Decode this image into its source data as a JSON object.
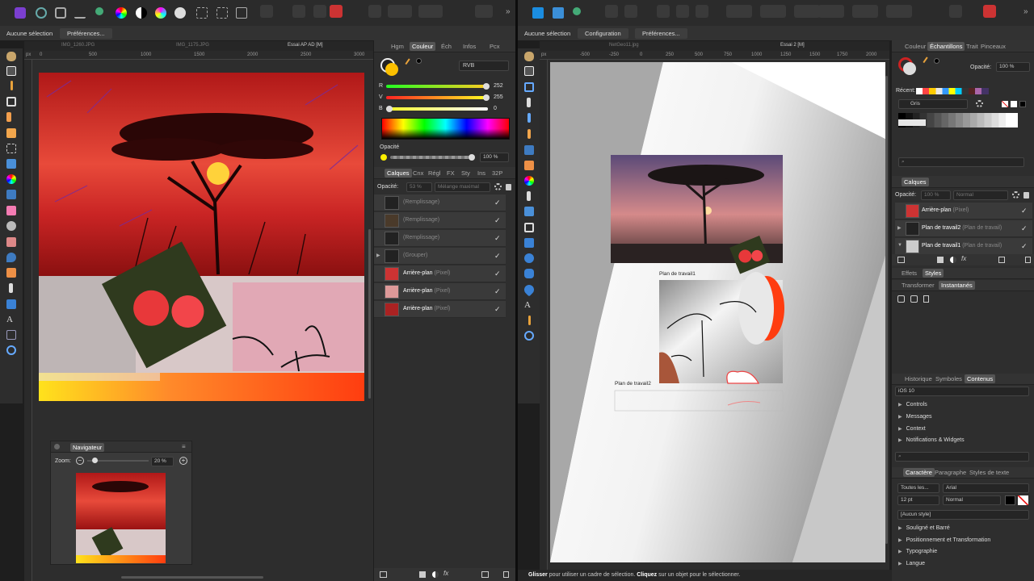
{
  "left": {
    "context": {
      "no_selection": "Aucune sélection",
      "prefs": "Préférences..."
    },
    "doc_tabs": [
      "IMG_1260.JPG",
      "IMG_1175.JPG",
      "Essai AP AD [M]"
    ],
    "ruler_unit": "px",
    "ruler_ticks": [
      "0",
      "500",
      "1000",
      "1500",
      "2000",
      "2500",
      "3000"
    ],
    "color_panel": {
      "tabs": [
        "Hgm",
        "Couleur",
        "Éch",
        "Infos",
        "Pcx"
      ],
      "mode": "RVB",
      "r_label": "R",
      "r": "252",
      "g_label": "V",
      "g": "255",
      "b_label": "B",
      "b": "0",
      "opacity_label": "Opacité",
      "opacity": "100 %"
    },
    "layers_panel": {
      "tabs": [
        "Calques",
        "Cnx",
        "Régl",
        "FX",
        "Sty",
        "Ins",
        "32P"
      ],
      "opacity_label": "Opacité:",
      "opacity": "53 %",
      "blend": "Mélange maximal",
      "layers": [
        {
          "name": "",
          "type": "(Remplissage)"
        },
        {
          "name": "",
          "type": "(Remplissage)"
        },
        {
          "name": "",
          "type": "(Remplissage)"
        },
        {
          "name": "",
          "type": "(Grouper)"
        },
        {
          "name": "Arrière-plan",
          "type": "(Pixel)"
        },
        {
          "name": "Arrière-plan",
          "type": "(Pixel)"
        },
        {
          "name": "Arrière-plan",
          "type": "(Pixel)"
        }
      ]
    },
    "navigator": {
      "title": "Navigateur",
      "zoom_label": "Zoom:",
      "zoom": "20 %"
    }
  },
  "right": {
    "context": {
      "no_selection": "Aucune sélection",
      "config": "Configuration",
      "prefs": "Préférences..."
    },
    "doc_tabs": [
      "NetGeo11.jpg",
      "Essai 2 [M]"
    ],
    "ruler_unit": "px",
    "ruler_ticks": [
      "-500",
      "-250",
      "0",
      "250",
      "500",
      "750",
      "1000",
      "1250",
      "1500",
      "1750",
      "2000"
    ],
    "artboard_labels": [
      "Plan de travail1",
      "Plan de travail2"
    ],
    "top_tabs": [
      "Couleur",
      "Échantillons",
      "Trait",
      "Pinceaux"
    ],
    "opacity_label": "Opacité:",
    "opacity": "100 %",
    "recent_label": "Récent:",
    "palette": "Gris",
    "layers_title": "Calques",
    "layers_opacity_label": "Opacité:",
    "layers_opacity": "100 %",
    "layers_blend": "Normal",
    "layers": [
      {
        "name": "Arrière-plan",
        "type": "(Pixel)"
      },
      {
        "name": "Plan de travail2",
        "type": "(Plan de travail)"
      },
      {
        "name": "Plan de travail1",
        "type": "(Plan de travail)"
      }
    ],
    "effects_tabs": [
      "Effets",
      "Styles"
    ],
    "transform_tabs": [
      "Transformer",
      "Instantanés"
    ],
    "assets_tabs": [
      "Historique",
      "Symboles",
      "Contenus"
    ],
    "assets_set": "iOS 10",
    "assets_items": [
      "Controls",
      "Messages",
      "Context",
      "Notifications & Widgets"
    ],
    "char_tabs": [
      "Caractère",
      "Paragraphe",
      "Styles de texte"
    ],
    "char": {
      "family_scope": "Toutes les...",
      "font": "Arial",
      "size": "12 pt",
      "weight": "Normal",
      "style": "[Aucun style]"
    },
    "char_sections": [
      "Souligné et Barré",
      "Positionnement et Transformation",
      "Typographie",
      "Langue"
    ],
    "status": {
      "b1": "Glisser",
      "t1": " pour utiliser un cadre de sélection. ",
      "b2": "Cliquez",
      "t2": " sur un objet pour le sélectionner."
    }
  }
}
